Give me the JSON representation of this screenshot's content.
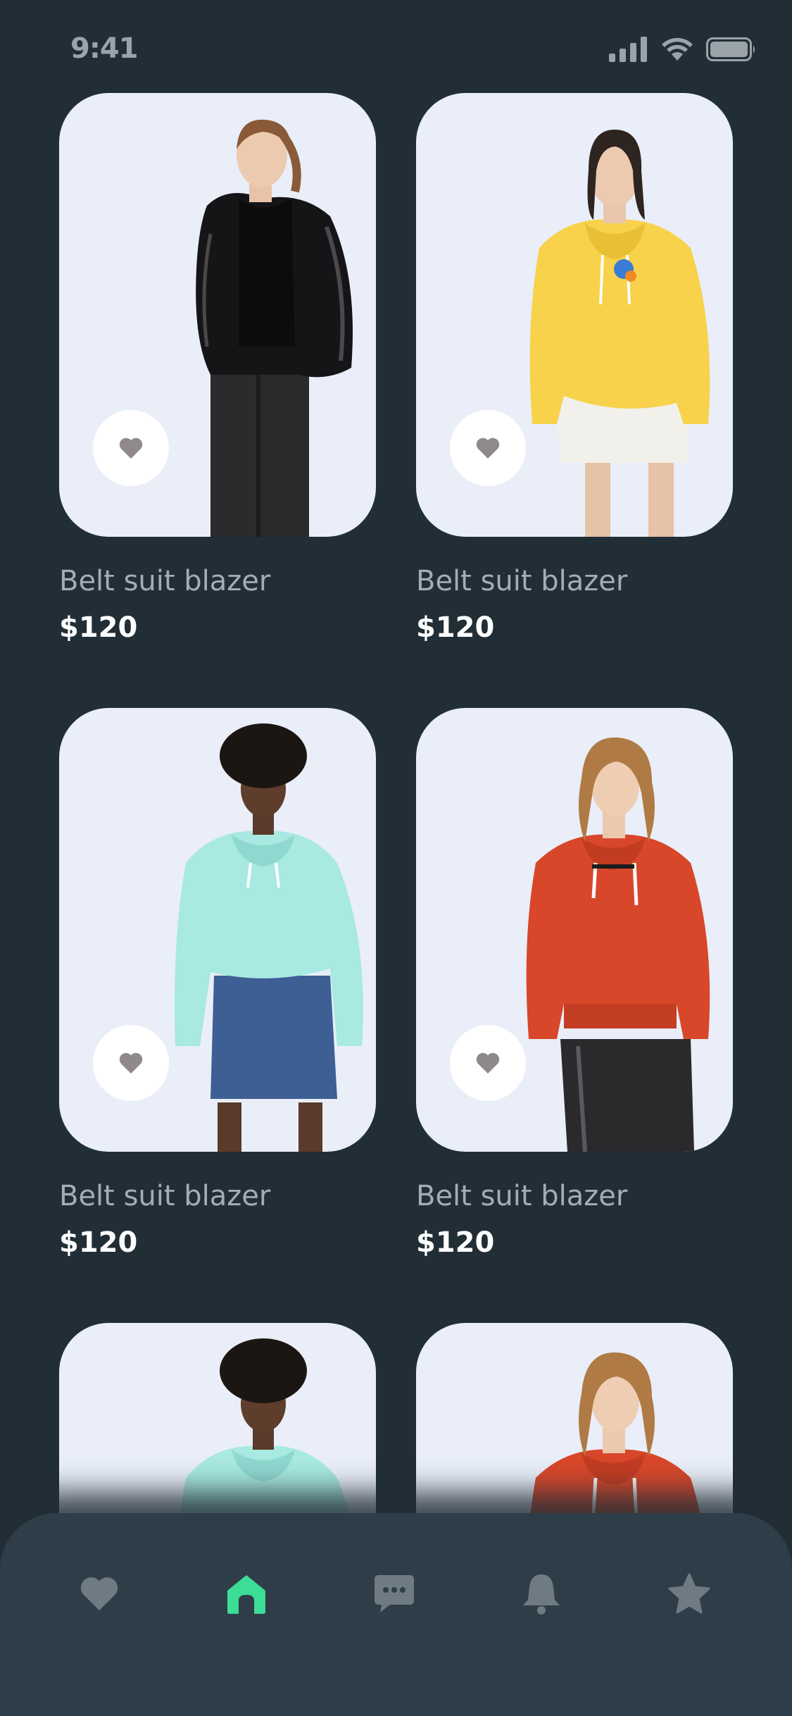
{
  "status_bar": {
    "time": "9:41",
    "icons": [
      "signal-icon",
      "wifi-icon",
      "battery-icon"
    ]
  },
  "products": [
    {
      "name": "Belt suit blazer",
      "price": "$120",
      "outfit": "black-puffer-jacket",
      "favorite_icon": "heart-icon"
    },
    {
      "name": "Belt suit blazer",
      "price": "$120",
      "outfit": "yellow-hoodie",
      "favorite_icon": "heart-icon"
    },
    {
      "name": "Belt suit blazer",
      "price": "$120",
      "outfit": "mint-hoodie",
      "favorite_icon": "heart-icon"
    },
    {
      "name": "Belt suit blazer",
      "price": "$120",
      "outfit": "orange-hoodie",
      "favorite_icon": "heart-icon"
    },
    {
      "name": "",
      "price": "",
      "outfit": "mint-hoodie",
      "favorite_icon": "heart-icon"
    },
    {
      "name": "",
      "price": "",
      "outfit": "orange-hoodie",
      "favorite_icon": "heart-icon"
    }
  ],
  "bottom_nav": {
    "items": [
      {
        "icon": "heart-icon",
        "active": false
      },
      {
        "icon": "home-icon",
        "active": true
      },
      {
        "icon": "chat-icon",
        "active": false
      },
      {
        "icon": "bell-icon",
        "active": false
      },
      {
        "icon": "star-icon",
        "active": false
      }
    ],
    "active_color": "#3ddc97",
    "inactive_color": "#6e7b83"
  },
  "colors": {
    "background": "#222e36",
    "card_background": "#e9eef8",
    "nav_background": "#2e3d47"
  }
}
